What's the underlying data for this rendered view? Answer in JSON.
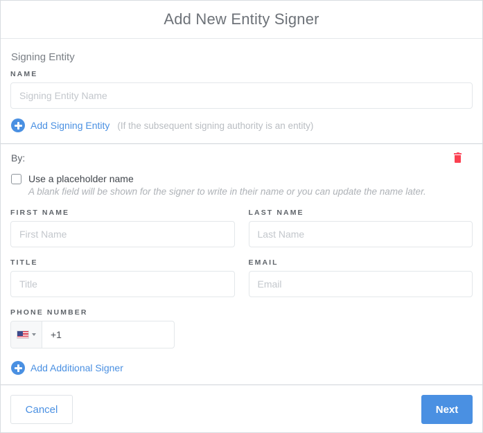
{
  "dialog": {
    "title": "Add New Entity Signer"
  },
  "signing_entity": {
    "heading": "Signing Entity",
    "name_label": "NAME",
    "name_placeholder": "Signing Entity Name",
    "name_value": "",
    "add_entity_label": "Add Signing Entity",
    "add_entity_hint": "(If the subsequent signing authority is an entity)"
  },
  "signer": {
    "by_label": "By:",
    "delete_icon": "trash-icon",
    "placeholder_checkbox_label": "Use a placeholder name",
    "placeholder_checkbox_hint": "A blank field will be shown for the signer to write in their name or you can update the name later.",
    "placeholder_checked": false,
    "fields": {
      "first_name_label": "FIRST NAME",
      "first_name_placeholder": "First Name",
      "first_name_value": "",
      "last_name_label": "LAST NAME",
      "last_name_placeholder": "Last Name",
      "last_name_value": "",
      "title_label": "TITLE",
      "title_placeholder": "Title",
      "title_value": "",
      "email_label": "EMAIL",
      "email_placeholder": "Email",
      "email_value": "",
      "phone_label": "PHONE NUMBER",
      "phone_value": "+1",
      "phone_country_flag": "us-flag-icon",
      "phone_country_caret": "chevron-down-icon"
    }
  },
  "add_signer": {
    "label": "Add Additional Signer"
  },
  "footer": {
    "cancel_label": "Cancel",
    "next_label": "Next"
  },
  "colors": {
    "accent_blue": "#4a90e2",
    "delete_red": "#fb4050",
    "title_gray": "#6d7278",
    "border_gray": "#e3e7ea"
  }
}
